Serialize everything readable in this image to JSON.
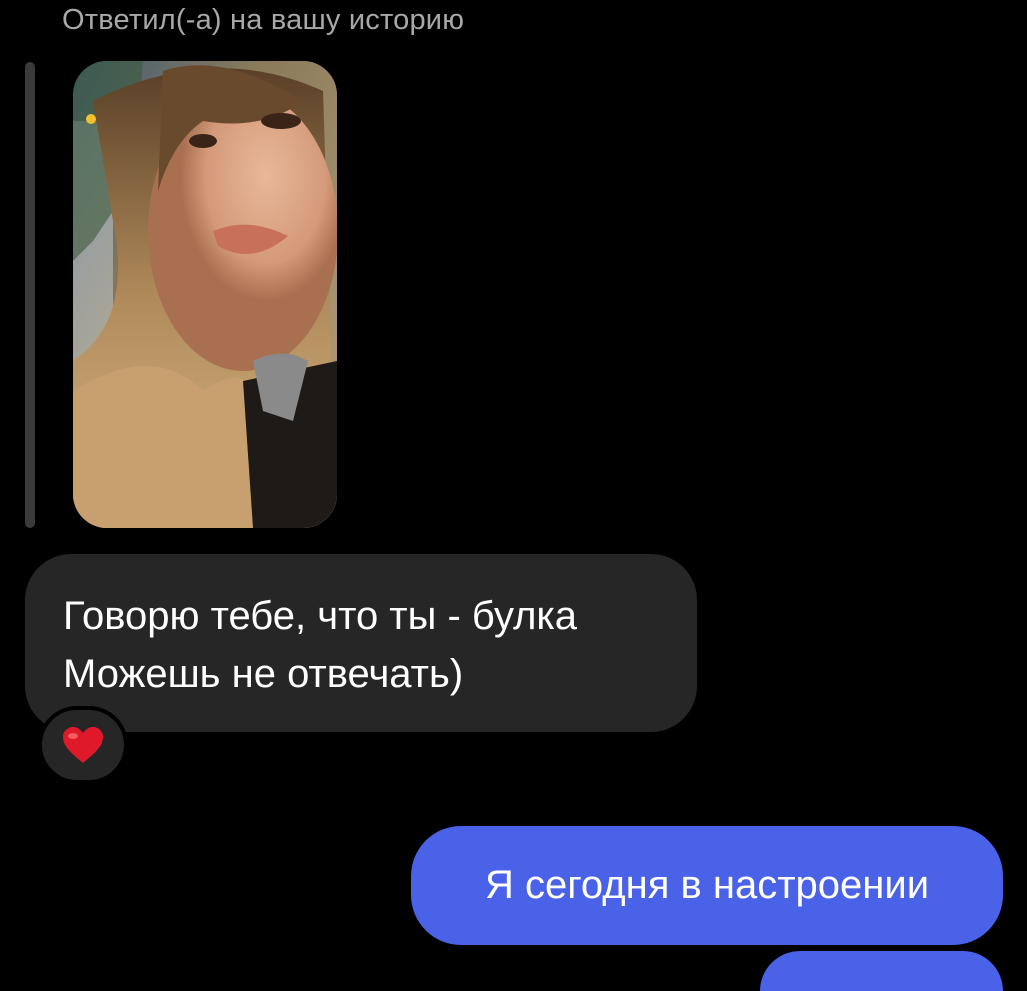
{
  "reply_caption": "Ответил(-а) на вашу историю",
  "story": {
    "image": "story-photo-portrait"
  },
  "incoming_message": {
    "lines": [
      "Говорю тебе, что ты - булка",
      "Можешь не отвечать)"
    ],
    "reaction": "❤️"
  },
  "outgoing_message": {
    "text": "Я сегодня в настроении"
  },
  "colors": {
    "background": "#000000",
    "incoming_bubble": "#262626",
    "outgoing_bubble": "#4a62e8",
    "caption_text": "#a8a8a8",
    "heart": "#e0192a"
  }
}
